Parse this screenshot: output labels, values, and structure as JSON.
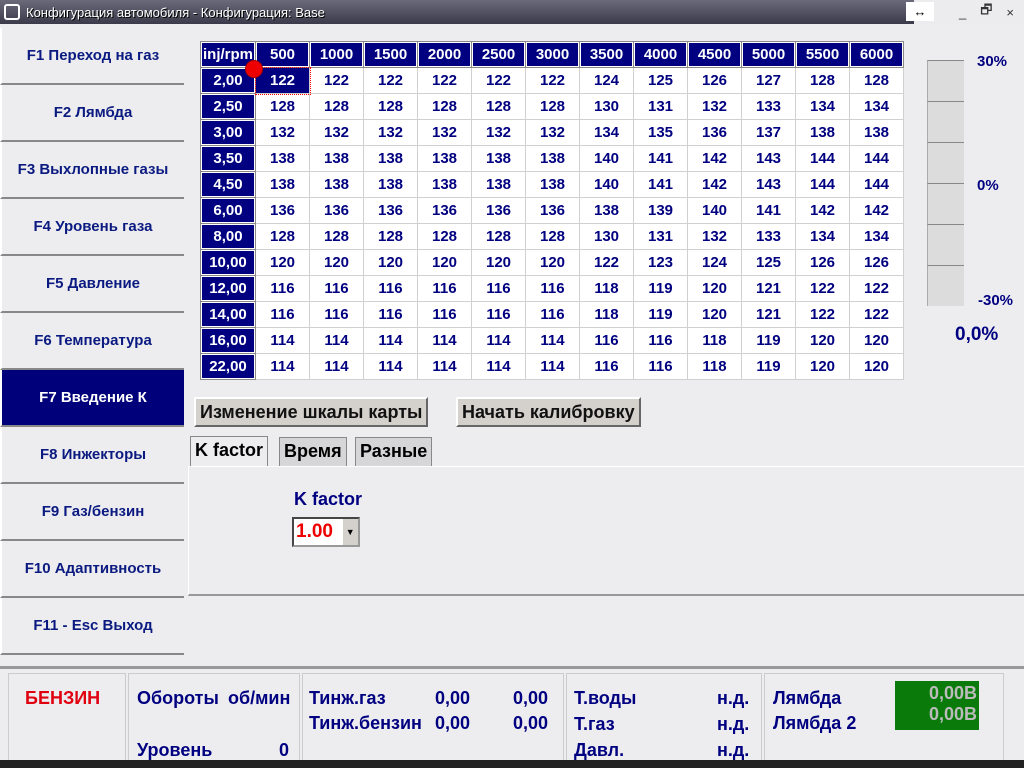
{
  "window": {
    "title": "Конфигурация автомобиля - Конфигурация: Base",
    "resize_glyph": "↔",
    "min": "_",
    "restore": "🗗",
    "close": "×"
  },
  "sidebar": [
    "F1 Переход на газ",
    "F2 Лямбда",
    "F3 Выхлопные газы",
    "F4 Уровень газа",
    "F5 Давление",
    "F6 Температура",
    "F7 Введение К",
    "F8 Инжекторы",
    "F9 Газ/бензин",
    "F10 Адаптивность",
    "F11 - Esc Выход"
  ],
  "sidebar_active": 6,
  "map": {
    "corner": "inj/rpm",
    "rpm": [
      "500",
      "1000",
      "1500",
      "2000",
      "2500",
      "3000",
      "3500",
      "4000",
      "4500",
      "5000",
      "5500",
      "6000"
    ],
    "rows": [
      {
        "inj": "2,00",
        "v": [
          122,
          122,
          122,
          122,
          122,
          122,
          124,
          125,
          126,
          127,
          128,
          128
        ]
      },
      {
        "inj": "2,50",
        "v": [
          128,
          128,
          128,
          128,
          128,
          128,
          130,
          131,
          132,
          133,
          134,
          134
        ]
      },
      {
        "inj": "3,00",
        "v": [
          132,
          132,
          132,
          132,
          132,
          132,
          134,
          135,
          136,
          137,
          138,
          138
        ]
      },
      {
        "inj": "3,50",
        "v": [
          138,
          138,
          138,
          138,
          138,
          138,
          140,
          141,
          142,
          143,
          144,
          144
        ]
      },
      {
        "inj": "4,50",
        "v": [
          138,
          138,
          138,
          138,
          138,
          138,
          140,
          141,
          142,
          143,
          144,
          144
        ]
      },
      {
        "inj": "6,00",
        "v": [
          136,
          136,
          136,
          136,
          136,
          136,
          138,
          139,
          140,
          141,
          142,
          142
        ]
      },
      {
        "inj": "8,00",
        "v": [
          128,
          128,
          128,
          128,
          128,
          128,
          130,
          131,
          132,
          133,
          134,
          134
        ]
      },
      {
        "inj": "10,00",
        "v": [
          120,
          120,
          120,
          120,
          120,
          120,
          122,
          123,
          124,
          125,
          126,
          126
        ]
      },
      {
        "inj": "12,00",
        "v": [
          116,
          116,
          116,
          116,
          116,
          116,
          118,
          119,
          120,
          121,
          122,
          122
        ]
      },
      {
        "inj": "14,00",
        "v": [
          116,
          116,
          116,
          116,
          116,
          116,
          118,
          119,
          120,
          121,
          122,
          122
        ]
      },
      {
        "inj": "16,00",
        "v": [
          114,
          114,
          114,
          114,
          114,
          114,
          116,
          116,
          118,
          119,
          120,
          120
        ]
      },
      {
        "inj": "22,00",
        "v": [
          114,
          114,
          114,
          114,
          114,
          114,
          116,
          116,
          118,
          119,
          120,
          120
        ]
      }
    ]
  },
  "gauge": {
    "top": "30%",
    "mid": "0%",
    "bottom": "-30%",
    "value": "0,0%"
  },
  "buttons": {
    "scale": "Изменение шкалы карты",
    "calib": "Начать калибровку"
  },
  "tabs": [
    "K factor",
    "Время",
    "Разные"
  ],
  "kfactor": {
    "label": "K factor",
    "value": "1.00"
  },
  "status": {
    "fuel": "БЕНЗИН",
    "rpm_label": "Обороты",
    "rpm_unit": "об/мин",
    "level_label": "Уровень",
    "level_value": "0",
    "tinj_gas": "Тинж.газ",
    "tinj_gas_v1": "0,00",
    "tinj_gas_v2": "0,00",
    "tinj_pet": "Тинж.бензин",
    "tinj_pet_v1": "0,00",
    "tinj_pet_v2": "0,00",
    "twater": "Т.воды",
    "twater_v": "н.д.",
    "tgas": "Т.газ",
    "tgas_v": "н.д.",
    "press": "Давл.",
    "press_v": "н.д.",
    "lambda": "Лямбда",
    "lambda_v": "0,00В",
    "lambda2": "Лямбда 2",
    "lambda2_v": "0,00В"
  }
}
